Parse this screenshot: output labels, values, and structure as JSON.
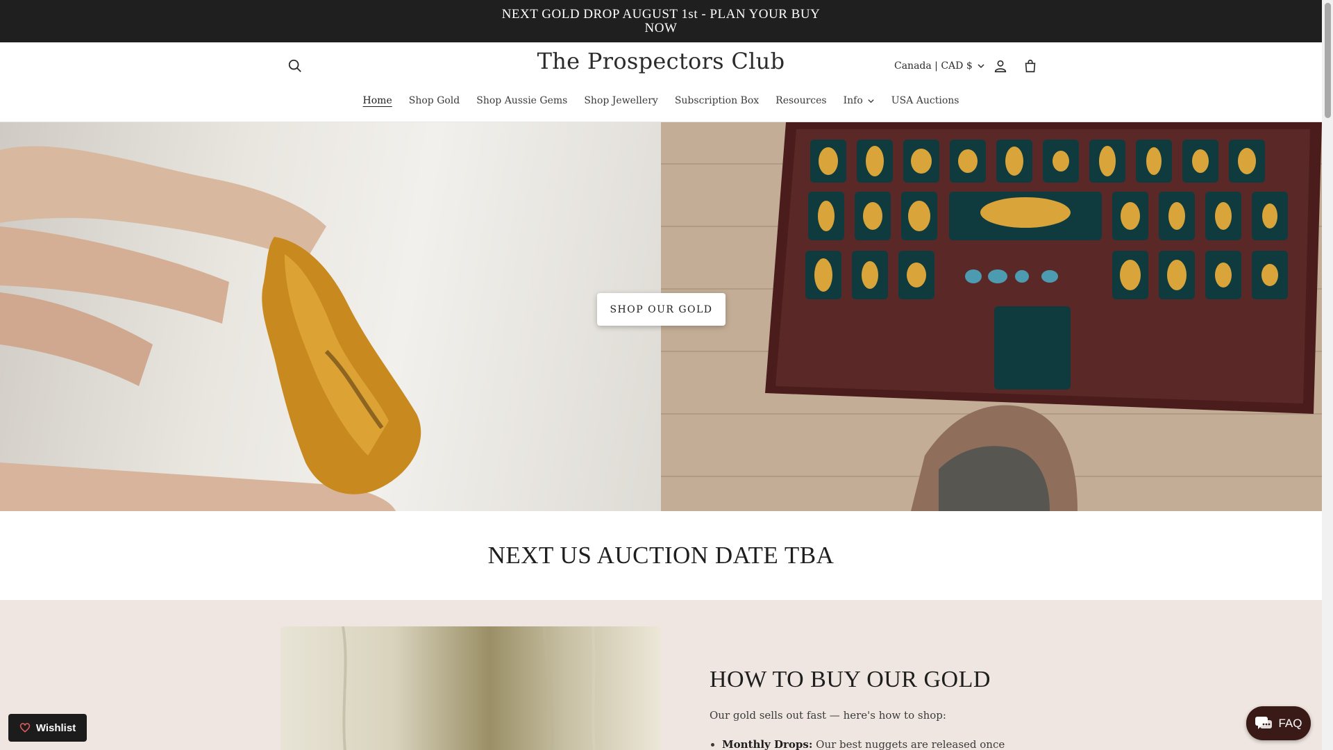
{
  "announcement": {
    "text": "NEXT GOLD DROP AUGUST 1st - PLAN YOUR BUY NOW"
  },
  "header": {
    "logo": "The Prospectors Club",
    "country_selector": "Canada | CAD $",
    "icons": {
      "search": "search-icon",
      "account": "account-icon",
      "cart": "cart-icon"
    }
  },
  "nav": {
    "items": [
      {
        "label": "Home",
        "active": true
      },
      {
        "label": "Shop Gold"
      },
      {
        "label": "Shop Aussie Gems"
      },
      {
        "label": "Shop Jewellery"
      },
      {
        "label": "Subscription Box"
      },
      {
        "label": "Resources"
      },
      {
        "label": "Info",
        "dropdown": true
      },
      {
        "label": "USA Auctions"
      }
    ]
  },
  "hero": {
    "button_label": "SHOP OUR GOLD"
  },
  "auction": {
    "heading": "NEXT US AUCTION DATE TBA"
  },
  "howto": {
    "title": "HOW TO BUY OUR GOLD",
    "intro": "Our gold sells out fast — here's how to shop:",
    "bullet_bold": "Monthly Drops:",
    "bullet_text": " Our best nuggets are released once"
  },
  "widgets": {
    "wishlist_label": "Wishlist",
    "faq_label": "FAQ"
  },
  "colors": {
    "announcement_bg": "#1f1f1f",
    "howto_bg": "#efe6e1",
    "faq_bg": "#3a1a17",
    "wishlist_bg": "#1c1c1c"
  }
}
